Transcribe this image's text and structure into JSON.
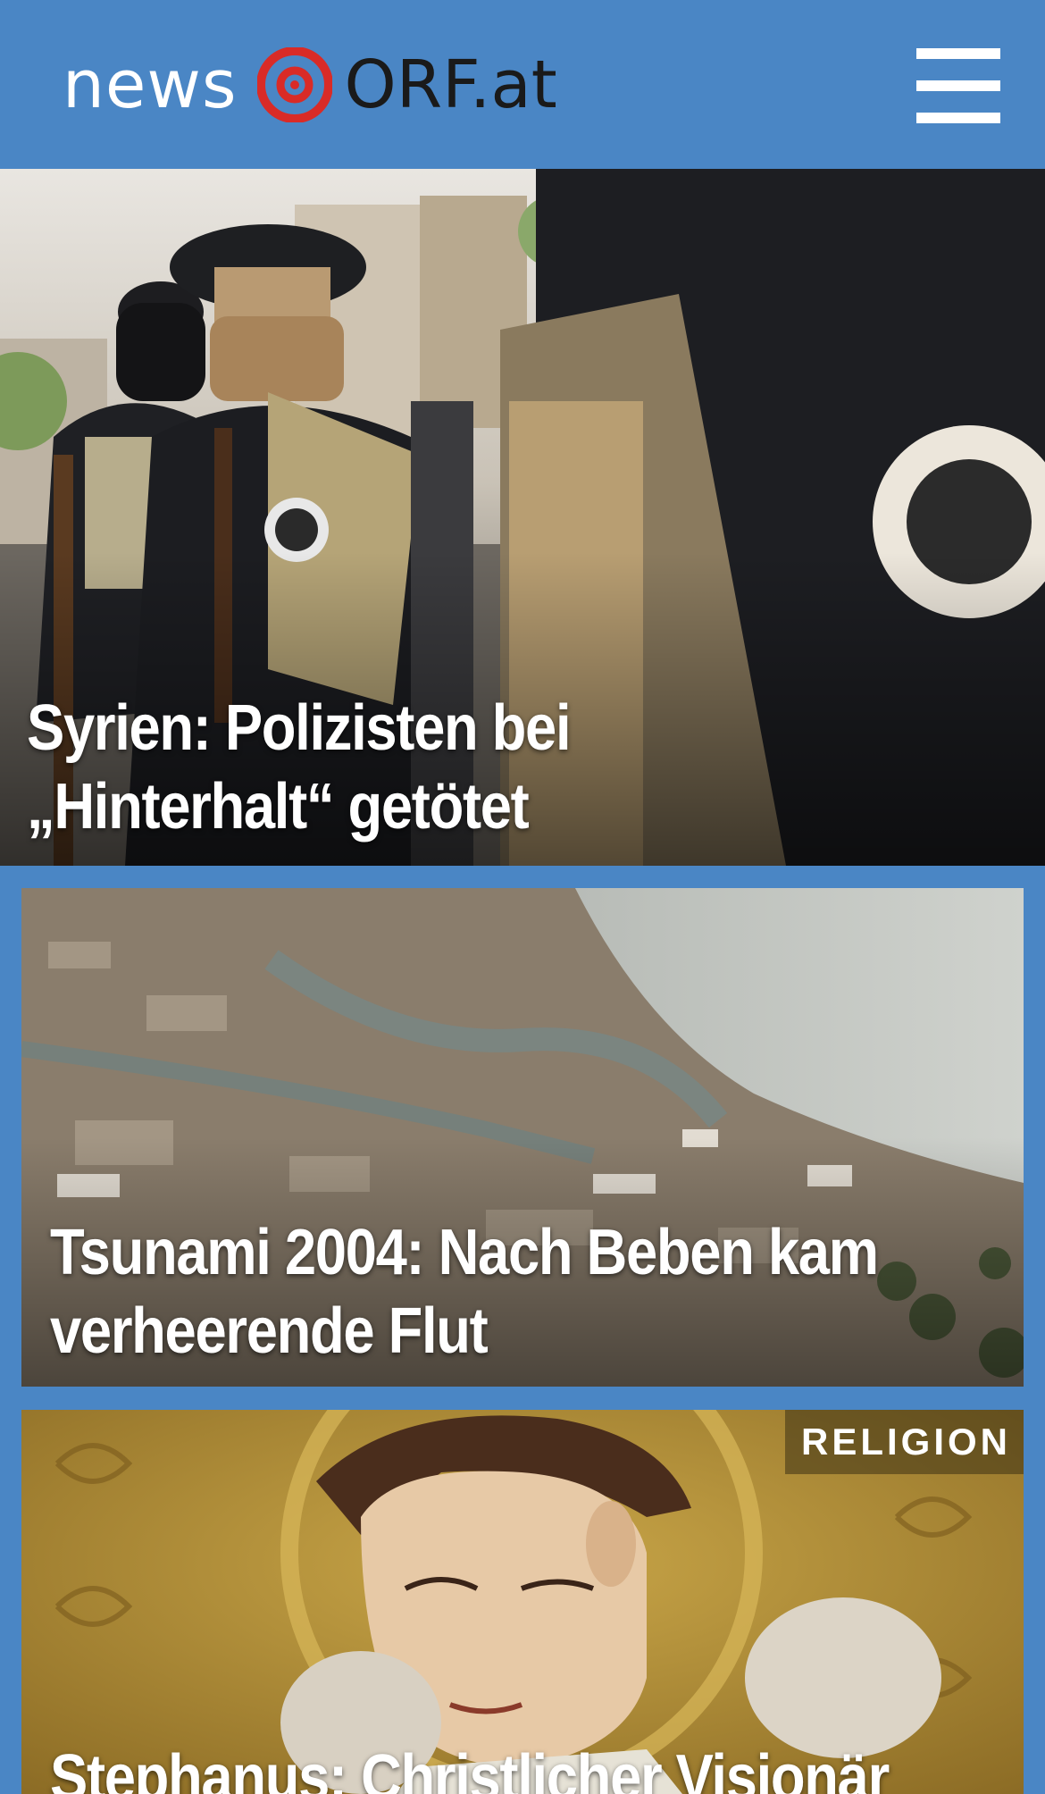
{
  "header": {
    "logo_news": "news",
    "logo_brand": "ORF.at",
    "menu_icon": "hamburger-menu-icon"
  },
  "articles": [
    {
      "title": "Syrien: Polizisten bei „Hinterhalt“ getötet",
      "image_desc": "armed-police-photo"
    },
    {
      "title": "Tsunami 2004: Nach Beben kam verheerende Flut",
      "image_desc": "aerial-flood-photo"
    },
    {
      "category": "RELIGION",
      "title": "Stephanus: Christlicher Visionär",
      "image_desc": "saint-painting"
    }
  ],
  "colors": {
    "brand_blue": "#4a86c5",
    "logo_red": "#d92b27",
    "text_white": "#ffffff"
  }
}
